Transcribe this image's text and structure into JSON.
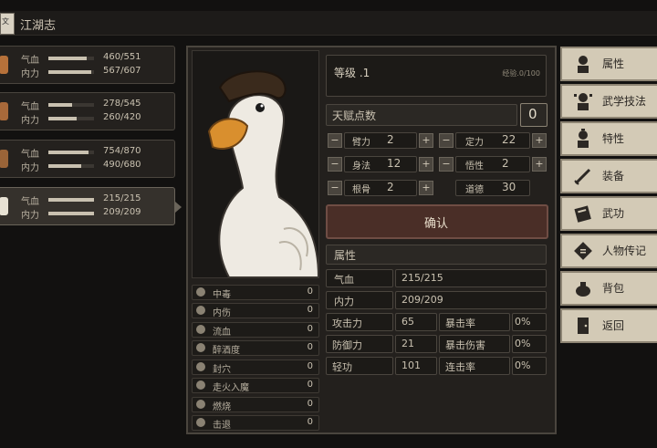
{
  "header": {
    "title": "江湖志",
    "icon_text": "文"
  },
  "party": [
    {
      "hp_label": "气血",
      "mp_label": "内力",
      "hp": "460/551",
      "mp": "567/607",
      "hp_pct": 0.83,
      "mp_pct": 0.93
    },
    {
      "hp_label": "气血",
      "mp_label": "内力",
      "hp": "278/545",
      "mp": "260/420",
      "hp_pct": 0.51,
      "mp_pct": 0.62
    },
    {
      "hp_label": "气血",
      "mp_label": "内力",
      "hp": "754/870",
      "mp": "490/680",
      "hp_pct": 0.87,
      "mp_pct": 0.72
    },
    {
      "hp_label": "气血",
      "mp_label": "内力",
      "hp": "215/215",
      "mp": "209/209",
      "hp_pct": 1.0,
      "mp_pct": 1.0,
      "selected": true
    }
  ],
  "level": {
    "label": "等级 .1",
    "exp": "经验.0/100"
  },
  "talent": {
    "label": "天赋点数",
    "value": "0"
  },
  "attrs": [
    {
      "name": "臂力",
      "value": "2"
    },
    {
      "name": "定力",
      "value": "22"
    },
    {
      "name": "身法",
      "value": "12"
    },
    {
      "name": "悟性",
      "value": "2"
    },
    {
      "name": "根骨",
      "value": "2"
    },
    {
      "name": "道德",
      "value": "30"
    }
  ],
  "confirm": "确认",
  "props": {
    "header": "属性",
    "hp_label": "气血",
    "hp": "215/215",
    "mp_label": "内力",
    "mp": "209/209",
    "rows": [
      {
        "l1": "攻击力",
        "v1": "65",
        "l2": "暴击率",
        "v2": "0%"
      },
      {
        "l1": "防御力",
        "v1": "21",
        "l2": "暴击伤害",
        "v2": "0%"
      },
      {
        "l1": "轻功",
        "v1": "101",
        "l2": "连击率",
        "v2": "0%"
      }
    ]
  },
  "statuses": [
    {
      "label": "中毒",
      "value": "0"
    },
    {
      "label": "内伤",
      "value": "0"
    },
    {
      "label": "流血",
      "value": "0"
    },
    {
      "label": "醉酒度",
      "value": "0"
    },
    {
      "label": "封穴",
      "value": "0"
    },
    {
      "label": "走火入魔",
      "value": "0"
    },
    {
      "label": "燃烧",
      "value": "0"
    },
    {
      "label": "击退",
      "value": "0"
    }
  ],
  "menu": [
    {
      "label": "属性",
      "icon": "person-icon"
    },
    {
      "label": "武学技法",
      "icon": "martial-person-icon"
    },
    {
      "label": "特性",
      "icon": "trait-person-icon"
    },
    {
      "label": "装备",
      "icon": "sword-icon"
    },
    {
      "label": "武功",
      "icon": "book-icon"
    },
    {
      "label": "人物传记",
      "icon": "scroll-icon"
    },
    {
      "label": "背包",
      "icon": "bag-icon"
    },
    {
      "label": "返回",
      "icon": "door-icon"
    }
  ],
  "colors": {
    "menu_bg": "#d3cab6",
    "panel_bg": "#23201d",
    "text": "#c9c1b0"
  }
}
